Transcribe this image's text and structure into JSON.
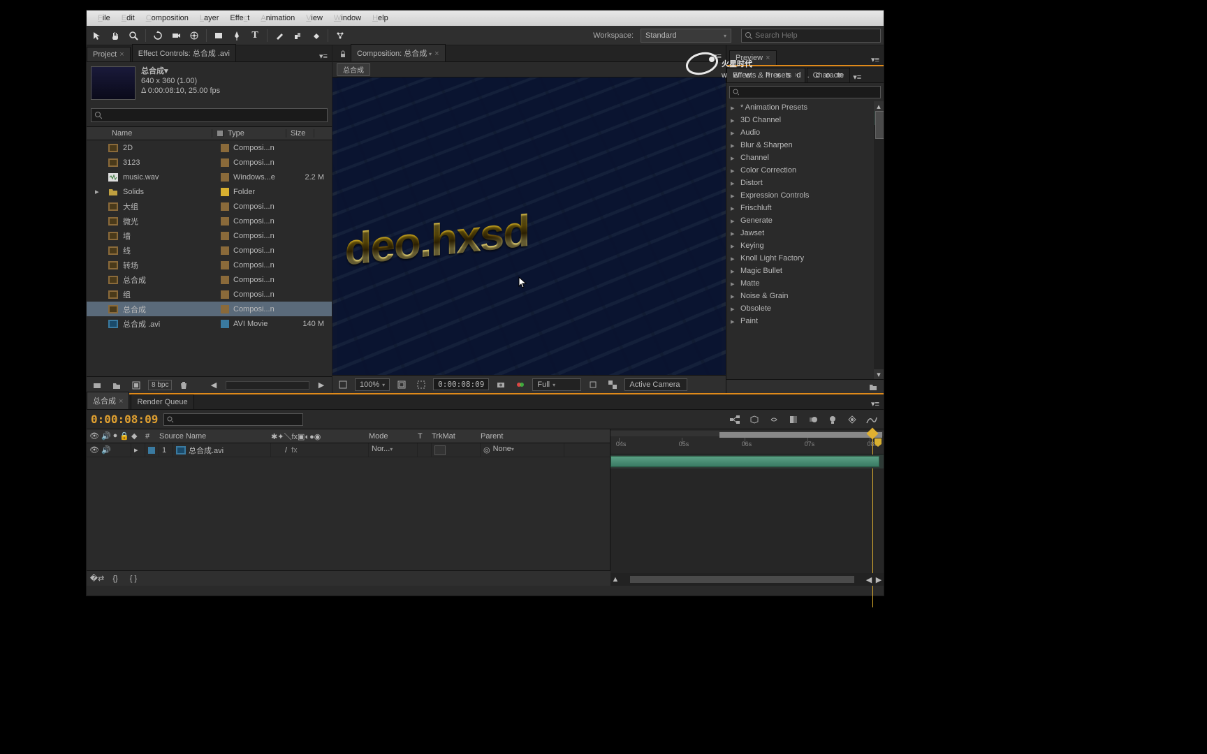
{
  "menubar": [
    "File",
    "Edit",
    "Composition",
    "Layer",
    "Effect",
    "Animation",
    "View",
    "Window",
    "Help"
  ],
  "workspace": {
    "label": "Workspace:",
    "value": "Standard"
  },
  "search_help_placeholder": "Search Help",
  "project_panel": {
    "tab_project": "Project",
    "tab_effect_controls": "Effect Controls: 总合成 .avi",
    "selected_name": "总合成▾",
    "dims": "640 x 360 (1.00)",
    "duration": "Δ 0:00:08:10, 25.00 fps",
    "columns": {
      "name": "Name",
      "type": "Type",
      "size": "Size"
    },
    "items": [
      {
        "icon": "comp",
        "name": "2D",
        "swatch": "#8a6a3a",
        "type": "Composi...n",
        "size": ""
      },
      {
        "icon": "comp",
        "name": "3123",
        "swatch": "#8a6a3a",
        "type": "Composi...n",
        "size": ""
      },
      {
        "icon": "audio",
        "name": "music.wav",
        "swatch": "#8a6a3a",
        "type": "Windows...e",
        "size": "2.2 M"
      },
      {
        "icon": "folder",
        "name": "Solids",
        "swatch": "#d8b030",
        "type": "Folder",
        "size": "",
        "twist": true
      },
      {
        "icon": "comp",
        "name": "大组",
        "swatch": "#8a6a3a",
        "type": "Composi...n",
        "size": ""
      },
      {
        "icon": "comp",
        "name": "微光",
        "swatch": "#8a6a3a",
        "type": "Composi...n",
        "size": ""
      },
      {
        "icon": "comp",
        "name": "墙",
        "swatch": "#8a6a3a",
        "type": "Composi...n",
        "size": ""
      },
      {
        "icon": "comp",
        "name": "线",
        "swatch": "#8a6a3a",
        "type": "Composi...n",
        "size": ""
      },
      {
        "icon": "comp",
        "name": "转场",
        "swatch": "#8a6a3a",
        "type": "Composi...n",
        "size": ""
      },
      {
        "icon": "comp",
        "name": "总合成",
        "swatch": "#8a6a3a",
        "type": "Composi...n",
        "size": ""
      },
      {
        "icon": "comp",
        "name": "组",
        "swatch": "#8a6a3a",
        "type": "Composi...n",
        "size": ""
      },
      {
        "icon": "comp",
        "name": "总合成",
        "swatch": "#8a6a3a",
        "type": "Composi...n",
        "size": "",
        "selected": true
      },
      {
        "icon": "avi",
        "name": "总合成 .avi",
        "swatch": "#3a7aa0",
        "type": "AVI Movie",
        "size": "140 M"
      }
    ],
    "bpc": "8 bpc"
  },
  "composition_panel": {
    "tab": "Composition: 总合成",
    "flow_pill": "总合成",
    "viewer_text": "deo.hxsd",
    "zoom": "100%",
    "timecode": "0:00:08:09",
    "resolution": "Full",
    "active_camera": "Active Camera"
  },
  "preview_tab": "Preview",
  "effects_panel": {
    "tab1": "Effects & Presets",
    "tab2": "Characte",
    "items": [
      "* Animation Presets",
      "3D Channel",
      "Audio",
      "Blur & Sharpen",
      "Channel",
      "Color Correction",
      "Distort",
      "Expression Controls",
      "Frischluft",
      "Generate",
      "Jawset",
      "Keying",
      "Knoll Light Factory",
      "Magic Bullet",
      "Matte",
      "Noise & Grain",
      "Obsolete",
      "Paint"
    ]
  },
  "timeline": {
    "tab_comp": "总合成",
    "tab_rq": "Render Queue",
    "timecode": "0:00:08:09",
    "col_num": "#",
    "col_source": "Source Name",
    "col_mode": "Mode",
    "col_t": "T",
    "col_trkmat": "TrkMat",
    "col_parent": "Parent",
    "layer": {
      "num": "1",
      "name": "总合成.avi",
      "mode": "Nor...",
      "parent": "None"
    },
    "ruler": [
      "04s",
      "05s",
      "06s",
      "07s",
      "08s"
    ]
  },
  "logo": {
    "main": "火星时代",
    "sub": "www.hxsd.com"
  }
}
